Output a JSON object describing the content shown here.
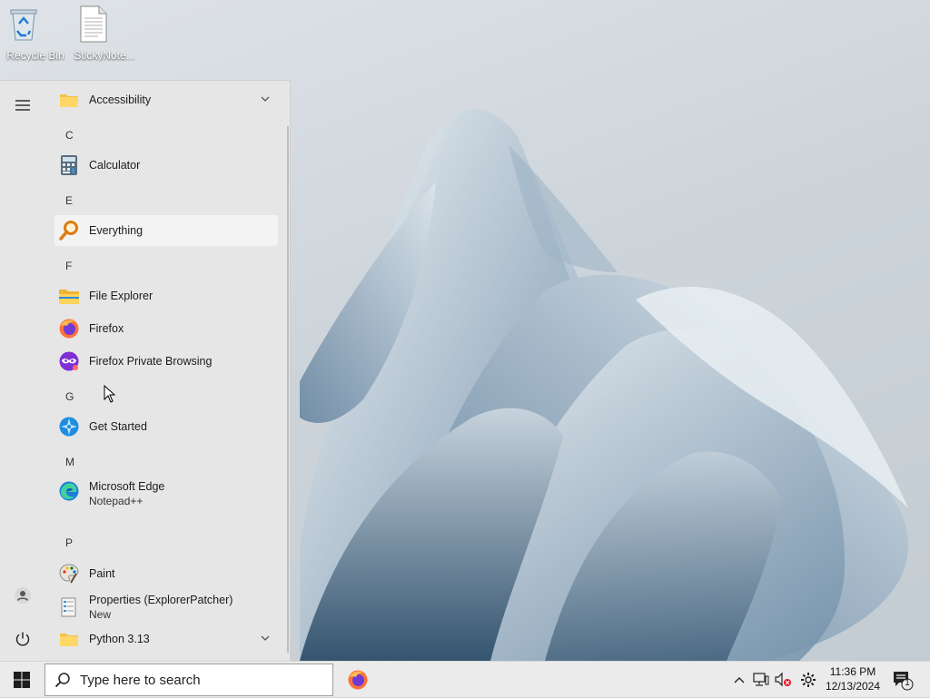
{
  "desktop": {
    "icons": [
      {
        "label": "Recycle Bin",
        "icon": "recycle-bin-icon"
      },
      {
        "label": "StickyNote...",
        "icon": "document-icon"
      }
    ]
  },
  "start_menu": {
    "rail": {
      "menu_icon": "hamburger-icon",
      "user_icon": "user-icon",
      "power_icon": "power-icon"
    },
    "apps": {
      "accessibility": "Accessibility",
      "letter_c": "C",
      "calculator": "Calculator",
      "letter_e": "E",
      "everything": "Everything",
      "letter_f": "F",
      "file_explorer": "File Explorer",
      "firefox": "Firefox",
      "firefox_private": "Firefox Private Browsing",
      "letter_g": "G",
      "get_started": "Get Started",
      "letter_m": "M",
      "edge": "Microsoft Edge",
      "notepadpp": "Notepad++",
      "letter_p": "P",
      "paint": "Paint",
      "properties": "Properties (ExplorerPatcher)",
      "properties_badge": "New",
      "python": "Python 3.13"
    }
  },
  "taskbar": {
    "search_placeholder": "Type here to search",
    "pinned": [
      "firefox-icon"
    ],
    "tray": [
      "chevron-up-icon",
      "network-icon",
      "volume-muted-icon",
      "settings-icon"
    ],
    "clock_time": "11:36 PM",
    "clock_date": "12/13/2024",
    "notification_count": "1"
  },
  "colors": {
    "accent": "#0078d4",
    "start_bg": "#e6e6e6",
    "taskbar_bg": "#ebebeb"
  }
}
